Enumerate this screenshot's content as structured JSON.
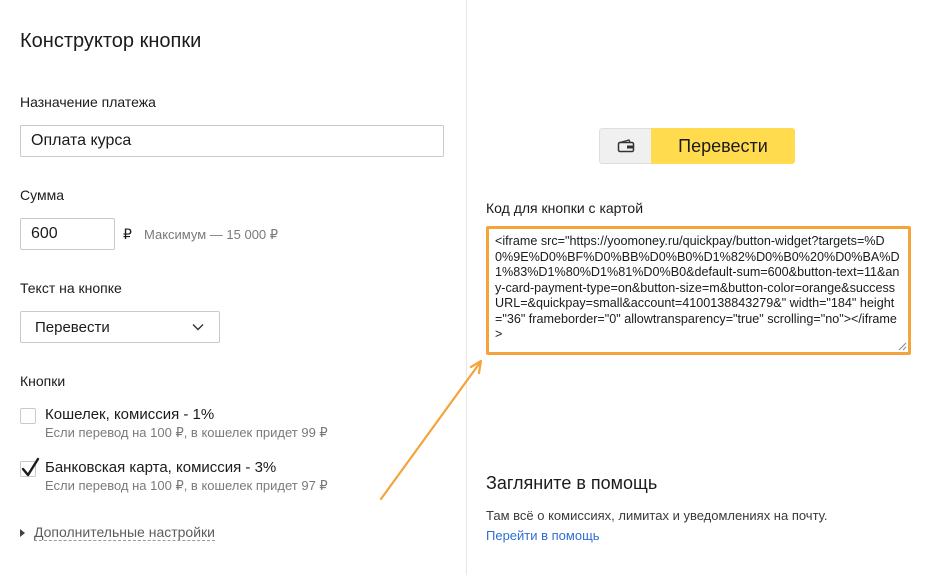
{
  "constructor": {
    "title": "Конструктор кнопки",
    "purpose": {
      "label": "Назначение платежа",
      "value": "Оплата курса"
    },
    "sum": {
      "label": "Сумма",
      "value": "600",
      "currency": "₽",
      "max_note": "Максимум — 15 000 ₽"
    },
    "button_text": {
      "label": "Текст на кнопке",
      "selected": "Перевести"
    },
    "buttons": {
      "label": "Кнопки",
      "options": [
        {
          "label": "Кошелек, комиссия - 1%",
          "hint": "Если перевод на 100 ₽, в кошелек придет 99 ₽",
          "checked": false
        },
        {
          "label": "Банковская карта, комиссия - 3%",
          "hint": "Если перевод на 100 ₽, в кошелек придет 97 ₽",
          "checked": true
        }
      ]
    },
    "advanced_link": "Дополнительные настройки"
  },
  "preview": {
    "button_label": "Перевести",
    "wallet_icon": "wallet-icon",
    "accent_color": "#ffdb4d"
  },
  "code": {
    "label": "Код для кнопки с картой",
    "value": "<iframe src=\"https://yoomoney.ru/quickpay/button-widget?targets=%D0%9E%D0%BF%D0%BB%D0%B0%D1%82%D0%B0%20%D0%BA%D1%83%D1%80%D1%81%D0%B0&default-sum=600&button-text=11&any-card-payment-type=on&button-size=m&button-color=orange&successURL=&quickpay=small&account=4100138843279&\" width=\"184\" height=\"36\" frameborder=\"0\" allowtransparency=\"true\" scrolling=\"no\"></iframe>",
    "highlight_color": "#f5a33b"
  },
  "help": {
    "title": "Загляните в помощь",
    "text": "Там всё о комиссиях, лимитах и уведомлениях на почту.",
    "link": "Перейти в помощь"
  }
}
